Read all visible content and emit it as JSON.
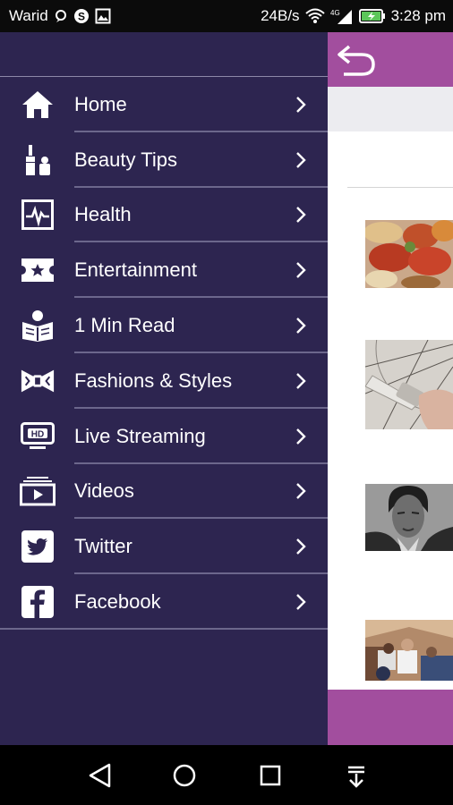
{
  "status_bar": {
    "carrier": "Warid",
    "speed": "24B/s",
    "signal": "4G",
    "time": "3:28 pm"
  },
  "drawer": {
    "items": [
      {
        "label": "Home",
        "icon": "home-icon"
      },
      {
        "label": "Beauty Tips",
        "icon": "lipstick-icon"
      },
      {
        "label": "Health",
        "icon": "heart-monitor-icon"
      },
      {
        "label": "Entertainment",
        "icon": "ticket-icon"
      },
      {
        "label": "1 Min Read",
        "icon": "reading-icon"
      },
      {
        "label": "Fashions & Styles",
        "icon": "bowtie-icon"
      },
      {
        "label": "Live Streaming",
        "icon": "hd-tv-icon"
      },
      {
        "label": "Videos",
        "icon": "video-stack-icon"
      },
      {
        "label": "Twitter",
        "icon": "twitter-icon"
      },
      {
        "label": "Facebook",
        "icon": "facebook-icon"
      }
    ]
  },
  "colors": {
    "drawer_bg": "#2d2550",
    "accent": "#a24e9e",
    "divider": "#6c678c"
  }
}
